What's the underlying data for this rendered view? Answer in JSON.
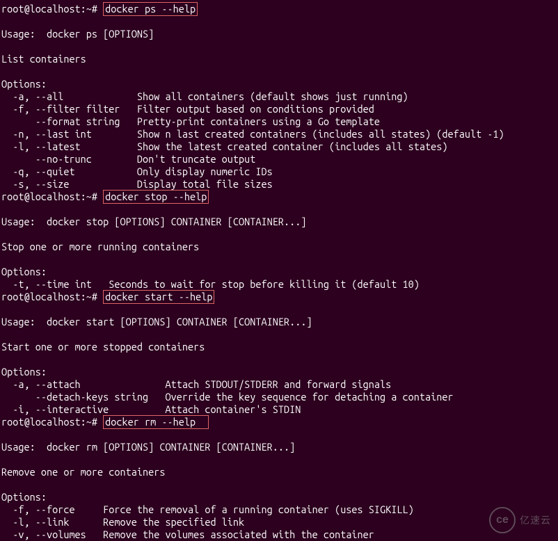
{
  "prompt": "root@localhost:~# ",
  "cmd1": "docker ps --help",
  "out1": "Usage:  docker ps [OPTIONS]\n\nList containers\n\nOptions:\n  -a, --all             Show all containers (default shows just running)\n  -f, --filter filter   Filter output based on conditions provided\n      --format string   Pretty-print containers using a Go template\n  -n, --last int        Show n last created containers (includes all states) (default -1)\n  -l, --latest          Show the latest created container (includes all states)\n      --no-trunc        Don't truncate output\n  -q, --quiet           Only display numeric IDs\n  -s, --size            Display total file sizes",
  "cmd2": "docker stop --help",
  "out2": "Usage:  docker stop [OPTIONS] CONTAINER [CONTAINER...]\n\nStop one or more running containers\n\nOptions:\n  -t, --time int   Seconds to wait for stop before killing it (default 10)",
  "cmd3": "docker start --help",
  "out3": "Usage:  docker start [OPTIONS] CONTAINER [CONTAINER...]\n\nStart one or more stopped containers\n\nOptions:\n  -a, --attach               Attach STDOUT/STDERR and forward signals\n      --detach-keys string   Override the key sequence for detaching a container\n  -i, --interactive          Attach container's STDIN",
  "cmd4": "docker rm --help",
  "cmd4_spacer": "  ",
  "out4": "Usage:  docker rm [OPTIONS] CONTAINER [CONTAINER...]\n\nRemove one or more containers\n\nOptions:\n  -f, --force     Force the removal of a running container (uses SIGKILL)\n  -l, --link      Remove the specified link\n  -v, --volumes   Remove the volumes associated with the container",
  "watermark": {
    "logo": "ce",
    "text": "亿速云"
  }
}
